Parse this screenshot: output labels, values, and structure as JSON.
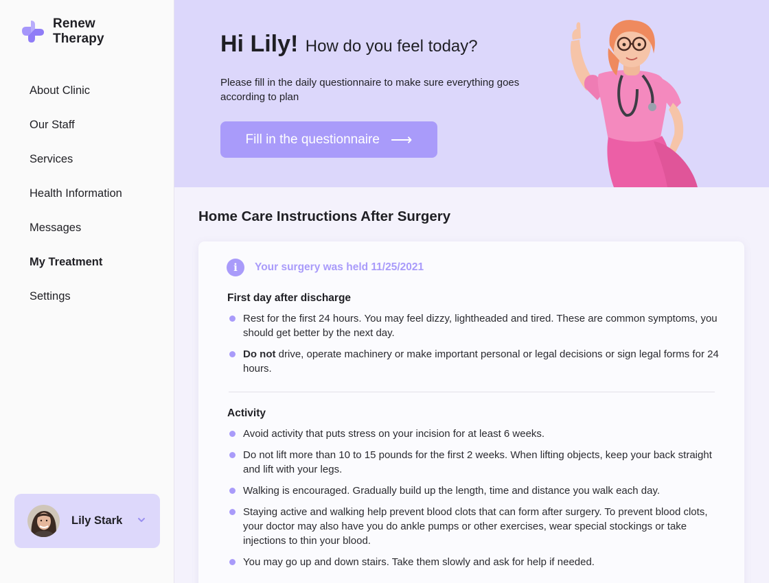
{
  "brand": {
    "line1": "Renew",
    "line2": "Therapy"
  },
  "nav": [
    {
      "label": "About Clinic"
    },
    {
      "label": "Our Staff"
    },
    {
      "label": "Services"
    },
    {
      "label": "Health Information"
    },
    {
      "label": "Messages"
    },
    {
      "label": "My Treatment",
      "active": true
    },
    {
      "label": "Settings"
    }
  ],
  "user": {
    "name": "Lily Stark"
  },
  "hero": {
    "greeting": "Hi Lily!",
    "question": "How do you feel today?",
    "description": "Please fill in the daily questionnaire to make sure everything goes according to plan",
    "cta_label": "Fill in the questionnaire",
    "cta_arrow": "⟶"
  },
  "content": {
    "title": "Home Care Instructions After Surgery",
    "info_icon": "i",
    "info_text": "Your surgery was held 11/25/2021",
    "first_day": {
      "heading": "First day after discharge",
      "item1": "Rest for the first 24 hours. You may feel dizzy, lightheaded and tired. These are common symptoms, you should get better by the next day.",
      "item2_bold": "Do not",
      "item2_rest": " drive, operate machinery or make important personal or legal decisions or sign legal forms for 24 hours."
    },
    "activity": {
      "heading": "Activity",
      "items": [
        "Avoid activity that puts stress on your incision for at least 6 weeks.",
        "Do not lift more than 10 to 15 pounds for the first 2 weeks. When lifting objects, keep your back straight and lift with your legs.",
        "Walking is encouraged. Gradually build up the length, time and distance you walk each day.",
        "Staying active and walking help prevent blood clots that can form after surgery. To prevent blood clots, your doctor may also have you do ankle pumps or other exercises, wear special stockings or take injections to thin your blood.",
        "You may go up and down stairs. Take them slowly and ask for help if needed."
      ]
    }
  },
  "icons": {
    "logo": "plus-logo-icon",
    "chevron": "chevron-down-icon",
    "info": "info-icon",
    "cta_arrow": "arrow-right-icon"
  },
  "colors": {
    "accent": "#a99bfa",
    "hero_bg": "#dcd7fb",
    "user_card_bg": "#ddd8fb"
  }
}
